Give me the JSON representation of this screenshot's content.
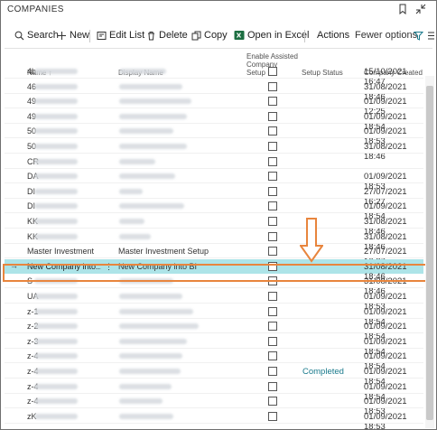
{
  "title": "COMPANIES",
  "actions": {
    "search": "Search",
    "new": "New",
    "edit_list": "Edit List",
    "delete": "Delete",
    "copy": "Copy",
    "open_in_excel": "Open in Excel",
    "actions": "Actions",
    "fewer_options": "Fewer options"
  },
  "columns": {
    "name": "Name ↑",
    "display_name": "Display Name",
    "assisted_1": "Enable Assisted",
    "assisted_2": "Company",
    "assisted_3": "Setup",
    "setup_status": "Setup Status",
    "created": "Company Created"
  },
  "rows": [
    {
      "name": "4b",
      "display": "",
      "date": "15/10/2021 16:47",
      "status": ""
    },
    {
      "name": "46",
      "display": "",
      "date": "31/08/2021 18:46",
      "status": ""
    },
    {
      "name": "49",
      "display": "",
      "date": "01/09/2021 12:25",
      "status": ""
    },
    {
      "name": "49",
      "display": "",
      "date": "01/09/2021 18:54",
      "status": ""
    },
    {
      "name": "50",
      "display": "",
      "date": "01/09/2021 18:53",
      "status": ""
    },
    {
      "name": "50",
      "display": "",
      "date": "31/08/2021 18:46",
      "status": ""
    },
    {
      "name": "CR",
      "display": "",
      "date": "",
      "status": ""
    },
    {
      "name": "DA",
      "display": "",
      "date": "01/09/2021 18:53",
      "status": ""
    },
    {
      "name": "DI",
      "display": "",
      "date": "27/07/2021 16:27",
      "status": ""
    },
    {
      "name": "DI",
      "display": "",
      "date": "01/09/2021 18:54",
      "status": ""
    },
    {
      "name": "KK",
      "display": "",
      "date": "31/08/2021 18:46",
      "status": ""
    },
    {
      "name": "KK",
      "display": "",
      "date": "31/08/2021 18:46",
      "status": ""
    },
    {
      "name": "Master Investment",
      "display": "Master Investment Setup",
      "date": "27/07/2021 16:27",
      "status": ""
    },
    {
      "name": "New Company into...",
      "display": "New Company into BI",
      "date": "31/08/2021 18:46",
      "status": "",
      "selected": true
    },
    {
      "name": "S",
      "display": "",
      "date": "31/08/2021 18:46",
      "status": ""
    },
    {
      "name": "UA",
      "display": "",
      "date": "01/09/2021 18:53",
      "status": ""
    },
    {
      "name": "z-1",
      "display": "",
      "date": "01/09/2021 18:54",
      "status": ""
    },
    {
      "name": "z-2",
      "display": "",
      "date": "01/09/2021 18:54",
      "status": ""
    },
    {
      "name": "z-3",
      "display": "",
      "date": "01/09/2021 18:54",
      "status": ""
    },
    {
      "name": "z-4",
      "display": "",
      "date": "01/09/2021 18:54",
      "status": ""
    },
    {
      "name": "z-4",
      "display": "",
      "date": "01/09/2021 18:54",
      "status": "Completed"
    },
    {
      "name": "z-4",
      "display": "",
      "date": "01/09/2021 18:54",
      "status": ""
    },
    {
      "name": "z-4",
      "display": "",
      "date": "01/09/2021 18:53",
      "status": ""
    },
    {
      "name": "zK",
      "display": "",
      "date": "01/09/2021 18:53",
      "status": ""
    }
  ],
  "colors": {
    "selected_row": "#ade4e8",
    "highlight_border": "#e8853d",
    "completed": "#1a7a8c"
  }
}
